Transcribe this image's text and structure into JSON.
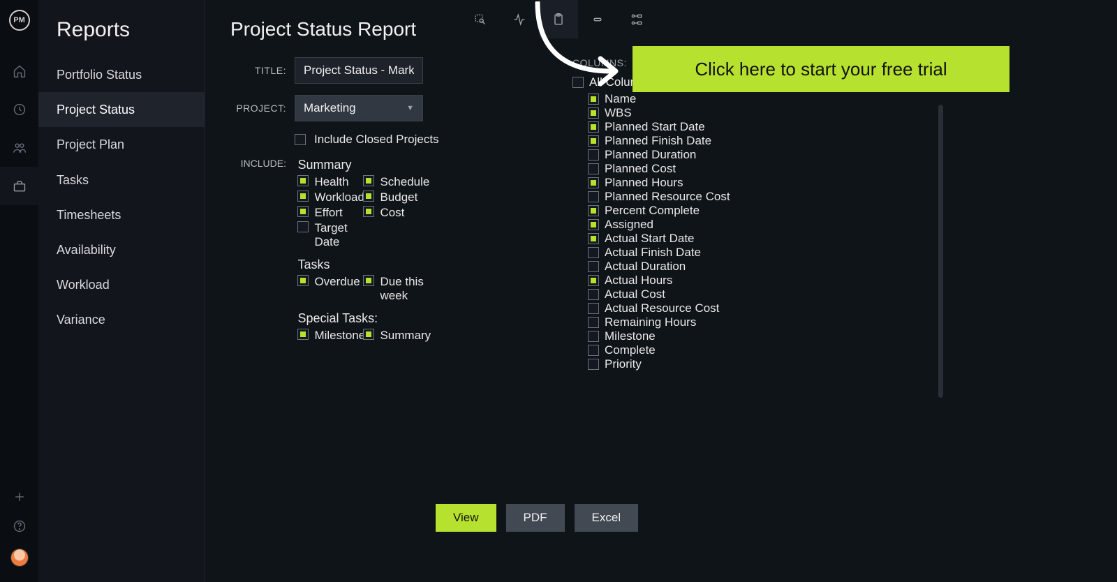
{
  "brand": "PM",
  "sidebar": {
    "title": "Reports",
    "items": [
      {
        "label": "Portfolio Status"
      },
      {
        "label": "Project Status"
      },
      {
        "label": "Project Plan"
      },
      {
        "label": "Tasks"
      },
      {
        "label": "Timesheets"
      },
      {
        "label": "Availability"
      },
      {
        "label": "Workload"
      },
      {
        "label": "Variance"
      }
    ],
    "active_index": 1
  },
  "page": {
    "title": "Project Status Report",
    "fields": {
      "title_label": "TITLE:",
      "title_value": "Project Status - Mark",
      "project_label": "PROJECT:",
      "project_value": "Marketing",
      "include_closed_label": "Include Closed Projects",
      "include_closed_checked": false,
      "include_label": "INCLUDE:"
    },
    "include": {
      "summary_header": "Summary",
      "summary_items": [
        {
          "label": "Health",
          "checked": true
        },
        {
          "label": "Schedule",
          "checked": true
        },
        {
          "label": "Workload",
          "checked": true
        },
        {
          "label": "Budget",
          "checked": true
        },
        {
          "label": "Effort",
          "checked": true
        },
        {
          "label": "Cost",
          "checked": true
        },
        {
          "label": "Target Date",
          "checked": false
        }
      ],
      "tasks_header": "Tasks",
      "tasks_items": [
        {
          "label": "Overdue",
          "checked": true
        },
        {
          "label": "Due this week",
          "checked": true
        }
      ],
      "special_header": "Special Tasks:",
      "special_items": [
        {
          "label": "Milestones",
          "checked": true
        },
        {
          "label": "Summary",
          "checked": true
        }
      ]
    },
    "columns": {
      "header": "COLUMNS:",
      "all_label": "All Columns",
      "all_checked": false,
      "items": [
        {
          "label": "Name",
          "checked": true
        },
        {
          "label": "WBS",
          "checked": true
        },
        {
          "label": "Planned Start Date",
          "checked": true
        },
        {
          "label": "Planned Finish Date",
          "checked": true
        },
        {
          "label": "Planned Duration",
          "checked": false
        },
        {
          "label": "Planned Cost",
          "checked": false
        },
        {
          "label": "Planned Hours",
          "checked": true
        },
        {
          "label": "Planned Resource Cost",
          "checked": false
        },
        {
          "label": "Percent Complete",
          "checked": true
        },
        {
          "label": "Assigned",
          "checked": true
        },
        {
          "label": "Actual Start Date",
          "checked": true
        },
        {
          "label": "Actual Finish Date",
          "checked": false
        },
        {
          "label": "Actual Duration",
          "checked": false
        },
        {
          "label": "Actual Hours",
          "checked": true
        },
        {
          "label": "Actual Cost",
          "checked": false
        },
        {
          "label": "Actual Resource Cost",
          "checked": false
        },
        {
          "label": "Remaining Hours",
          "checked": false
        },
        {
          "label": "Milestone",
          "checked": false
        },
        {
          "label": "Complete",
          "checked": false
        },
        {
          "label": "Priority",
          "checked": false
        }
      ]
    },
    "buttons": {
      "view": "View",
      "pdf": "PDF",
      "excel": "Excel"
    }
  },
  "cta": {
    "label": "Click here to start your free trial"
  }
}
